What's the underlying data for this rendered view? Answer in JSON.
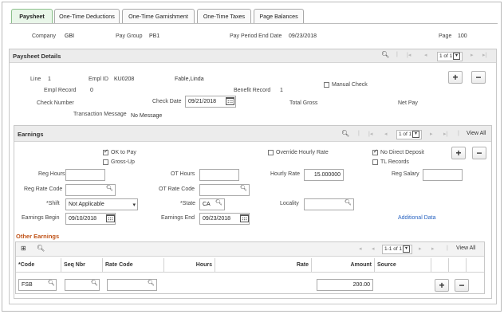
{
  "tabs": [
    {
      "label": "Paysheet"
    },
    {
      "label": "One-Time Deductions"
    },
    {
      "label": "One-Time Garnishment"
    },
    {
      "label": "One-Time Taxes"
    },
    {
      "label": "Page Balances"
    }
  ],
  "header": {
    "company_label": "Company",
    "company_value": "GBI",
    "paygroup_label": "Pay Group",
    "paygroup_value": "PB1",
    "period_label": "Pay Period End Date",
    "period_value": "09/23/2018",
    "page_label": "Page",
    "page_value": "100"
  },
  "details": {
    "title": "Paysheet Details",
    "pager": "1 of 1",
    "line_label": "Line",
    "line_value": "1",
    "emplid_label": "Empl ID",
    "emplid_value": "KU0208",
    "name_value": "Fable,Linda",
    "emplrec_label": "Empl Record",
    "emplrec_value": "0",
    "benrec_label": "Benefit Record",
    "benrec_value": "1",
    "manual_check_label": "Manual Check",
    "check_number_label": "Check Number",
    "check_date_label": "Check Date",
    "check_date_value": "09/21/2018",
    "total_gross_label": "Total Gross",
    "net_pay_label": "Net Pay",
    "trans_msg_label": "Transaction Message",
    "trans_msg_value": "No Message"
  },
  "earnings": {
    "title": "Earnings",
    "pager": "1 of 1",
    "view_all": "View All",
    "ok_to_pay": "OK to Pay",
    "gross_up": "Gross-Up",
    "override_hourly": "Override Hourly Rate",
    "no_direct_deposit": "No Direct Deposit",
    "tl_records": "TL Records",
    "reg_hours_label": "Reg Hours",
    "ot_hours_label": "OT Hours",
    "hourly_rate_label": "Hourly Rate",
    "hourly_rate_value": "15.000000",
    "reg_salary_label": "Reg Salary",
    "reg_rate_code_label": "Reg Rate Code",
    "ot_rate_code_label": "OT Rate Code",
    "shift_label": "*Shift",
    "shift_value": "Not Applicable",
    "state_label": "*State",
    "state_value": "CA",
    "locality_label": "Locality",
    "earn_begin_label": "Earnings Begin",
    "earn_begin_value": "09/10/2018",
    "earn_end_label": "Earnings End",
    "earn_end_value": "09/23/2018",
    "additional_data": "Additional Data"
  },
  "other_earnings": {
    "title": "Other Earnings",
    "pager": "1-1 of 1",
    "view_all": "View All",
    "columns": [
      "*Code",
      "Seq Nbr",
      "Rate Code",
      "Hours",
      "Rate",
      "Amount",
      "Source"
    ],
    "row": {
      "code": "FSB",
      "amount": "200.00"
    }
  },
  "colors": {
    "accent": "#2a64c1",
    "section_title": "#c0541a",
    "active_tab": "#e9f6e9"
  }
}
